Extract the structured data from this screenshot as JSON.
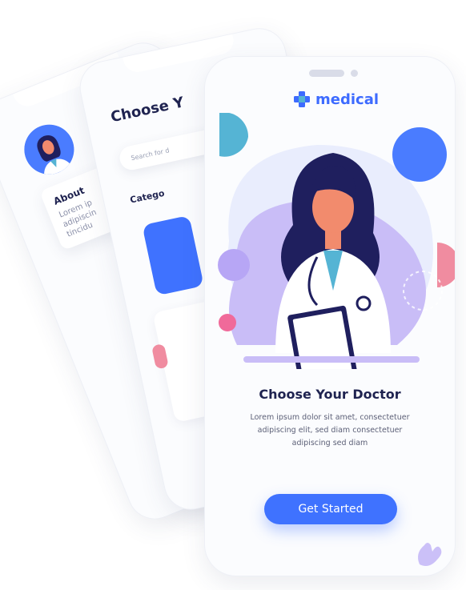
{
  "front": {
    "brand": "medical",
    "title": "Choose Your Doctor",
    "desc_line1": "Lorem ipsum dolor sit amet, consectetuer",
    "desc_line2": "adipiscing elit, sed diam consectetuer",
    "desc_line3": "adipiscing sed diam",
    "cta": "Get Started"
  },
  "middle": {
    "title": "Choose Y",
    "search_placeholder": "Search for d",
    "section": "Catego"
  },
  "back": {
    "about": "About",
    "about_line1": "Lorem ip",
    "about_line2": "adipiscin",
    "about_line3": "tincidu"
  },
  "colors": {
    "accent": "#3f72ff",
    "purple": "#b7a6f5",
    "pink": "#f08ca0",
    "teal": "#55b4d4",
    "navy": "#1f2350"
  }
}
